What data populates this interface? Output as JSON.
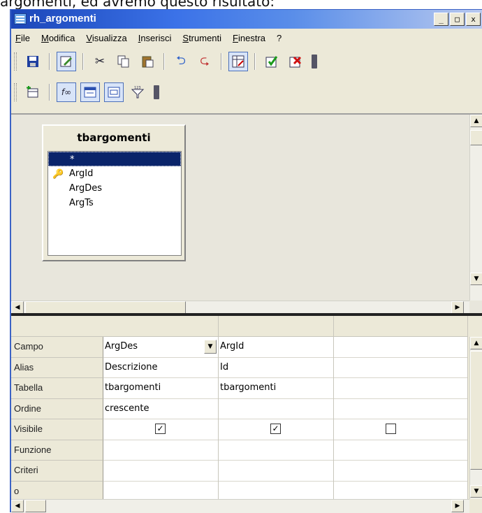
{
  "caption": "argomenti, ed avremo questo risultato:",
  "window": {
    "title": "rh_argomenti",
    "controls": [
      "_",
      "□",
      "x"
    ]
  },
  "menu": [
    "File",
    "Modifica",
    "Visualizza",
    "Inserisci",
    "Strumenti",
    "Finestra",
    "?"
  ],
  "toolbar1_icons": [
    "save-icon",
    "edit-mode-icon",
    "cut-icon",
    "copy-icon",
    "paste-icon",
    "undo-icon",
    "redo-icon",
    "design-view-icon",
    "run-query-icon",
    "clear-query-icon"
  ],
  "toolbar2_icons": [
    "add-table-icon",
    "functions-icon",
    "table-name-icon",
    "alias-icon",
    "distinct-values-icon"
  ],
  "table_box": {
    "name": "tbargomenti",
    "fields": [
      "*",
      "ArgId",
      "ArgDes",
      "ArgTs"
    ],
    "selected": "*",
    "primary_key": "ArgId"
  },
  "grid": {
    "row_labels": [
      "Campo",
      "Alias",
      "Tabella",
      "Ordine",
      "Visibile",
      "Funzione",
      "Criteri",
      "o"
    ],
    "columns": [
      {
        "campo": "ArgDes",
        "alias": "Descrizione",
        "tabella": "tbargomenti",
        "ordine": "crescente",
        "visibile": true,
        "funzione": "",
        "criteri": "",
        "o": ""
      },
      {
        "campo": "ArgId",
        "alias": "Id",
        "tabella": "tbargomenti",
        "ordine": "",
        "visibile": true,
        "funzione": "",
        "criteri": "",
        "o": ""
      },
      {
        "campo": "",
        "alias": "",
        "tabella": "",
        "ordine": "",
        "visibile": false,
        "funzione": "",
        "criteri": "",
        "o": ""
      }
    ]
  }
}
